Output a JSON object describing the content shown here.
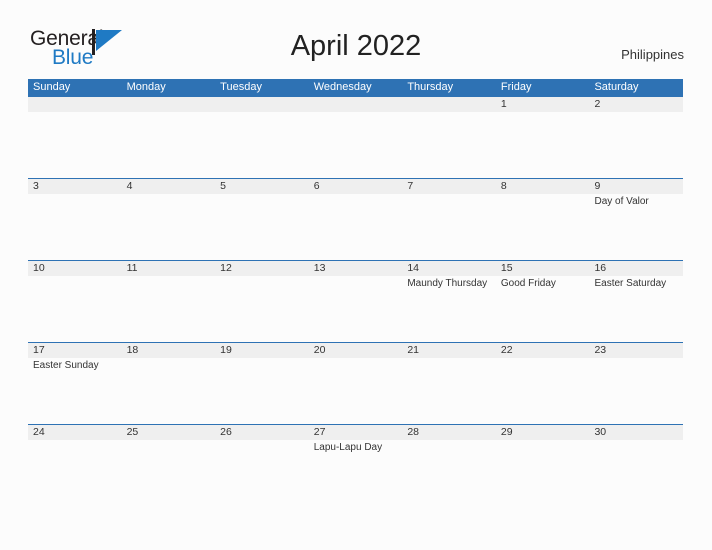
{
  "brand": {
    "name_part1": "General",
    "name_part2": "Blue",
    "logo_icon": "flag-triangle-icon",
    "color_dark": "#231f20",
    "color_blue": "#1f7ac4"
  },
  "header": {
    "title": "April 2022",
    "country": "Philippines"
  },
  "theme": {
    "header_blue": "#2e72b4",
    "date_strip": "#efefef",
    "page_background": "#fcfcfc",
    "text": "#333333"
  },
  "calendar": {
    "month": "April",
    "year": "2022",
    "weekday_headers": [
      "Sunday",
      "Monday",
      "Tuesday",
      "Wednesday",
      "Thursday",
      "Friday",
      "Saturday"
    ],
    "weeks": [
      {
        "days": [
          {
            "num": "",
            "event": ""
          },
          {
            "num": "",
            "event": ""
          },
          {
            "num": "",
            "event": ""
          },
          {
            "num": "",
            "event": ""
          },
          {
            "num": "",
            "event": ""
          },
          {
            "num": "1",
            "event": ""
          },
          {
            "num": "2",
            "event": ""
          }
        ]
      },
      {
        "days": [
          {
            "num": "3",
            "event": ""
          },
          {
            "num": "4",
            "event": ""
          },
          {
            "num": "5",
            "event": ""
          },
          {
            "num": "6",
            "event": ""
          },
          {
            "num": "7",
            "event": ""
          },
          {
            "num": "8",
            "event": ""
          },
          {
            "num": "9",
            "event": "Day of Valor"
          }
        ]
      },
      {
        "days": [
          {
            "num": "10",
            "event": ""
          },
          {
            "num": "11",
            "event": ""
          },
          {
            "num": "12",
            "event": ""
          },
          {
            "num": "13",
            "event": ""
          },
          {
            "num": "14",
            "event": "Maundy Thursday"
          },
          {
            "num": "15",
            "event": "Good Friday"
          },
          {
            "num": "16",
            "event": "Easter Saturday"
          }
        ]
      },
      {
        "days": [
          {
            "num": "17",
            "event": "Easter Sunday"
          },
          {
            "num": "18",
            "event": ""
          },
          {
            "num": "19",
            "event": ""
          },
          {
            "num": "20",
            "event": ""
          },
          {
            "num": "21",
            "event": ""
          },
          {
            "num": "22",
            "event": ""
          },
          {
            "num": "23",
            "event": ""
          }
        ]
      },
      {
        "days": [
          {
            "num": "24",
            "event": ""
          },
          {
            "num": "25",
            "event": ""
          },
          {
            "num": "26",
            "event": ""
          },
          {
            "num": "27",
            "event": "Lapu-Lapu Day"
          },
          {
            "num": "28",
            "event": ""
          },
          {
            "num": "29",
            "event": ""
          },
          {
            "num": "30",
            "event": ""
          }
        ]
      }
    ]
  }
}
